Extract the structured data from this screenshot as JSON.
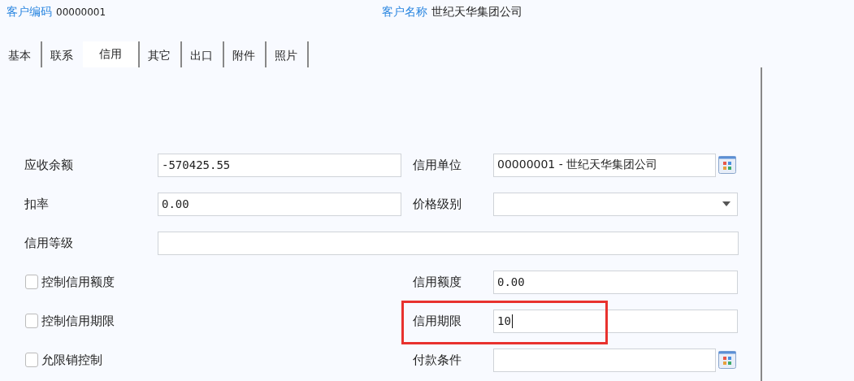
{
  "header": {
    "code_label": "客户编码",
    "code_value": "00000001",
    "name_label": "客户名称",
    "name_value": "世纪天华集团公司"
  },
  "tabs": [
    {
      "label": "基本",
      "selected": false
    },
    {
      "label": "联系",
      "selected": false
    },
    {
      "label": "信用",
      "selected": true
    },
    {
      "label": "其它",
      "selected": false
    },
    {
      "label": "出口",
      "selected": false
    },
    {
      "label": "附件",
      "selected": false
    },
    {
      "label": "照片",
      "selected": false
    }
  ],
  "form": {
    "rows": [
      {
        "left": {
          "kind": "text",
          "label": "应收余额",
          "value": "-570425.55"
        },
        "right": {
          "kind": "picker",
          "label": "信用单位",
          "value": "00000001 - 世纪天华集团公司"
        }
      },
      {
        "left": {
          "kind": "text",
          "label": "扣率",
          "value": "0.00"
        },
        "right": {
          "kind": "dropdown",
          "label": "价格级别"
        }
      },
      {
        "left": {
          "kind": "wide",
          "label": "信用等级"
        }
      },
      {
        "left": {
          "kind": "checkbox",
          "label": "控制信用额度",
          "checked": false
        },
        "right": {
          "kind": "text",
          "label": "信用额度",
          "value": "0.00"
        }
      },
      {
        "left": {
          "kind": "checkbox",
          "label": "控制信用期限",
          "checked": false
        },
        "right": {
          "kind": "text",
          "label": "信用期限",
          "value": "10",
          "focused": true,
          "highlighted": true
        }
      },
      {
        "left": {
          "kind": "checkbox",
          "label": "允限销控制",
          "checked": false
        },
        "right": {
          "kind": "picker",
          "label": "付款条件"
        }
      }
    ]
  }
}
